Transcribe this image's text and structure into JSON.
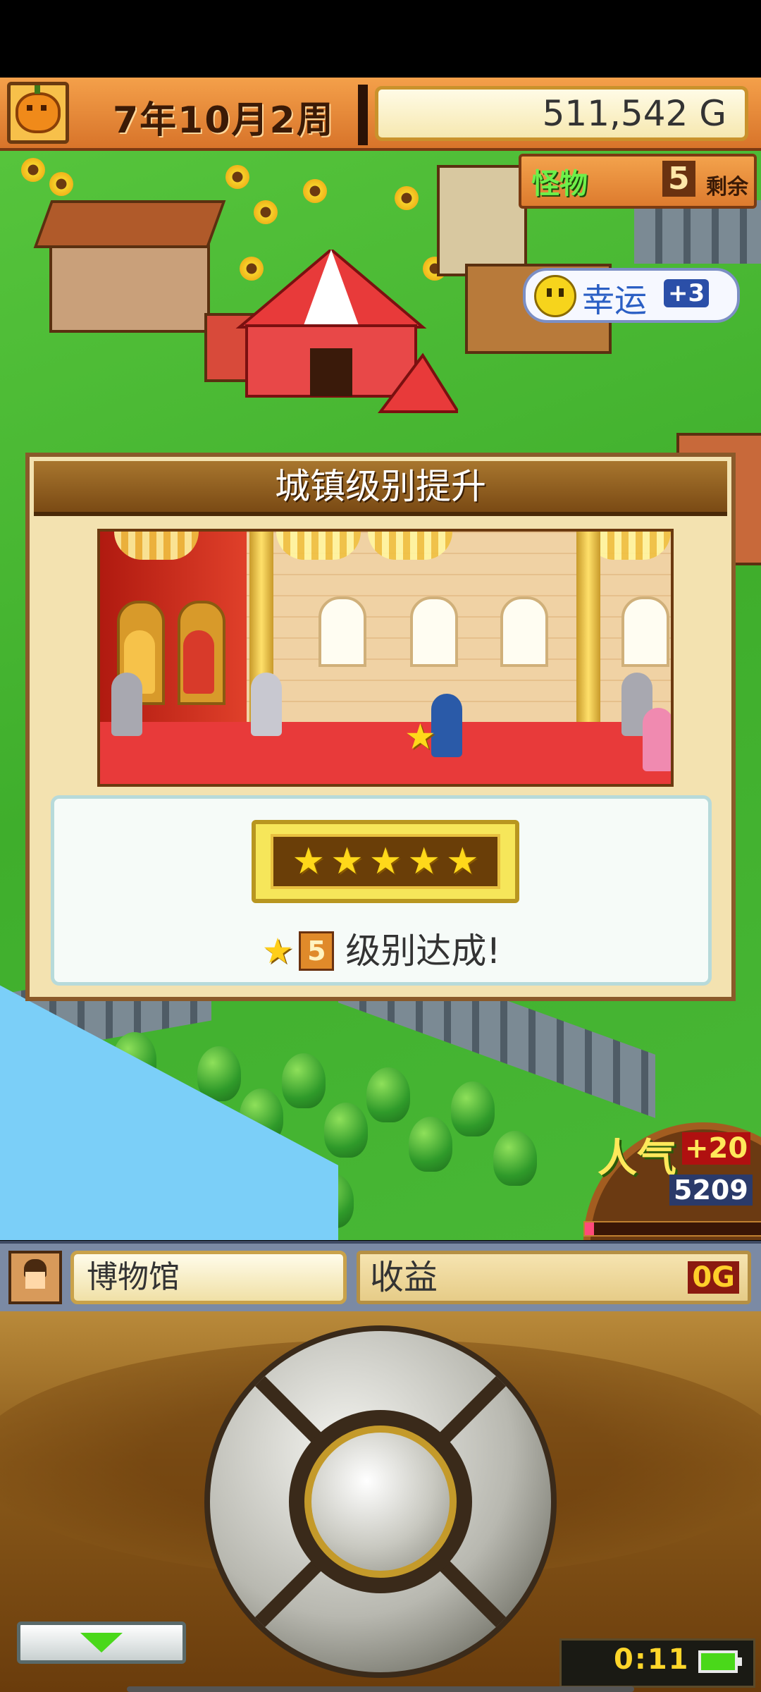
{
  "hud": {
    "date": "7年10月2周",
    "money": "511,542 G"
  },
  "world": {
    "monster_label": "怪物",
    "monster_count": "5",
    "monster_remaining_label": "剩余",
    "luck_label": "幸运",
    "luck_bonus": "+3",
    "popularity_label": "人气",
    "popularity_bonus": "+20",
    "popularity_value": "5209",
    "popularity_progress": 0.05
  },
  "dialog": {
    "title": "城镇级别提升",
    "stars": [
      "★",
      "★",
      "★",
      "★",
      "★"
    ],
    "level": "5",
    "achieve_text": "级别达成!"
  },
  "info_bar": {
    "building_name": "博物馆",
    "income_label": "收益",
    "income_value": "0G"
  },
  "controller": {
    "clock": "0:11"
  },
  "colors": {
    "hud_orange": "#e07e32",
    "grass": "#4cb838",
    "dialog_bg": "#f3e2b0",
    "star_gold": "#ffd81a",
    "controller_brown": "#8a5a1a"
  }
}
